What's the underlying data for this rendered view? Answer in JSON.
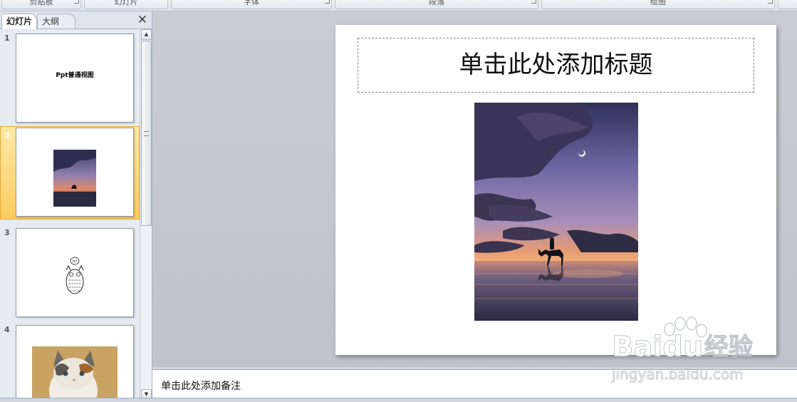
{
  "ribbon": {
    "groups": [
      "剪贴板",
      "幻灯片",
      "字体",
      "段落",
      "绘图"
    ]
  },
  "left_pane": {
    "tab_slides": "幻灯片",
    "tab_outline": "大纲",
    "close_glyph": "✕",
    "slides": [
      {
        "number": "1",
        "title": "Ppt普通视图"
      },
      {
        "number": "2"
      },
      {
        "number": "3",
        "speech_text": "hi!"
      },
      {
        "number": "4"
      }
    ],
    "scroll_up": "▲",
    "scroll_down": "▼"
  },
  "slide": {
    "title_placeholder": "单击此处添加标题"
  },
  "notes": {
    "placeholder": "单击此处添加备注"
  },
  "watermark": {
    "brand": "Baidu",
    "suffix": "经验",
    "url": "jingyan.baidu.com"
  },
  "colors": {
    "selected_slide": "#fbcc60",
    "workspace": "#c4c8d0"
  }
}
